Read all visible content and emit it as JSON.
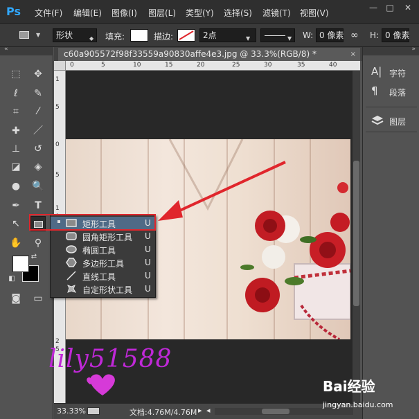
{
  "app": {
    "logo": "Ps"
  },
  "menu": [
    "文件(F)",
    "编辑(E)",
    "图像(I)",
    "图层(L)",
    "类型(Y)",
    "选择(S)",
    "滤镜(T)",
    "视图(V)"
  ],
  "window_controls": {
    "minimize": "—",
    "maximize": "□",
    "close": "✕"
  },
  "options": {
    "mode_value": "形状",
    "fill_label": "填充:",
    "stroke_label": "描边:",
    "stroke_width": "2点",
    "w_label": "W:",
    "w_value": "0 像素",
    "h_label": "H:",
    "h_value": "0 像素",
    "link_icon": "∞"
  },
  "document": {
    "tab_title": "c60a905572f98f33559a90830affe4e3.jpg @ 33.3%(RGB/8) *",
    "close": "×",
    "ruler_h": [
      "0",
      "5",
      "10",
      "15",
      "20",
      "25",
      "30",
      "35",
      "40"
    ],
    "ruler_v": [
      "1",
      "5",
      "0",
      "5",
      "1",
      "0",
      "1",
      "5",
      "2",
      "0",
      "2",
      "5"
    ]
  },
  "status": {
    "zoom": "33.33%",
    "doc_info": "文档:4.76M/4.76M"
  },
  "flyout": {
    "items": [
      {
        "label": "矩形工具",
        "key": "U",
        "icon": "rectangle-icon",
        "selected": true
      },
      {
        "label": "圆角矩形工具",
        "key": "U",
        "icon": "rounded-rectangle-icon",
        "selected": false
      },
      {
        "label": "椭圆工具",
        "key": "U",
        "icon": "ellipse-icon",
        "selected": false
      },
      {
        "label": "多边形工具",
        "key": "U",
        "icon": "polygon-icon",
        "selected": false
      },
      {
        "label": "直线工具",
        "key": "U",
        "icon": "line-icon",
        "selected": false
      },
      {
        "label": "自定形状工具",
        "key": "U",
        "icon": "custom-shape-icon",
        "selected": false
      }
    ]
  },
  "panels": {
    "character": {
      "icon": "A|",
      "label": "字符"
    },
    "paragraph": {
      "icon": "¶",
      "label": "段落"
    },
    "layers": {
      "label": "图层"
    }
  },
  "watermark": {
    "signature": "lily51588",
    "brand": "Bai经验",
    "url": "jingyan.baidu.com"
  },
  "colors": {
    "highlight": "#e0262c",
    "accent": "#31a8ff",
    "signature": "#c028d8"
  }
}
